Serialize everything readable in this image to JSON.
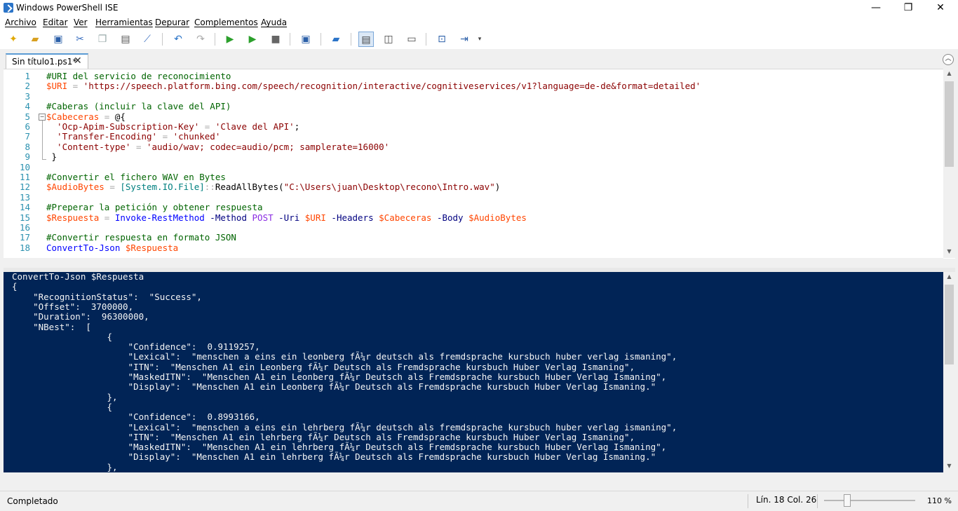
{
  "window": {
    "title": "Windows PowerShell ISE",
    "minimize": "—",
    "restore": "❐",
    "close": "✕"
  },
  "menu": [
    "Archivo",
    "Editar",
    "Ver",
    "Herramientas",
    "Depurar",
    "Complementos",
    "Ayuda"
  ],
  "toolbar": {
    "icons": [
      "new-icon",
      "open-icon",
      "save-icon",
      "cut-icon",
      "copy-icon",
      "paste-icon",
      "clear-icon",
      "undo-icon",
      "redo-icon",
      "run-icon",
      "run-selection-icon",
      "stop-icon",
      "new-remote-tab-icon",
      "start-powershell-icon",
      "layout-top-icon",
      "layout-right-icon",
      "layout-max-icon",
      "show-commands-icon",
      "show-addon-icon",
      "toolbar-overflow-icon"
    ]
  },
  "tab": {
    "label": "Sin título1.ps1*",
    "close": "✕"
  },
  "editor": {
    "lines": [
      {
        "n": "1",
        "tokens": [
          [
            "c-com",
            "#URI del servicio de reconocimiento"
          ]
        ]
      },
      {
        "n": "2",
        "tokens": [
          [
            "c-var",
            "$URI"
          ],
          [
            "c-op",
            " = "
          ],
          [
            "c-str",
            "'https://speech.platform.bing.com/speech/recognition/interactive/cognitiveservices/v1?language=de-de&format=detailed'"
          ]
        ]
      },
      {
        "n": "3",
        "tokens": []
      },
      {
        "n": "4",
        "tokens": [
          [
            "c-com",
            "#Caberas (incluir la clave del API)"
          ]
        ]
      },
      {
        "n": "5",
        "tokens": [
          [
            "c-var",
            "$Cabeceras"
          ],
          [
            "c-op",
            " = "
          ],
          [
            "c-txt",
            "@{"
          ]
        ]
      },
      {
        "n": "6",
        "tokens": [
          [
            "c-str",
            "  'Ocp-Apim-Subscription-Key'"
          ],
          [
            "c-op",
            " = "
          ],
          [
            "c-str",
            "'Clave del API'"
          ],
          [
            "c-txt",
            ";"
          ]
        ]
      },
      {
        "n": "7",
        "tokens": [
          [
            "c-str",
            "  'Transfer-Encoding'"
          ],
          [
            "c-op",
            " = "
          ],
          [
            "c-str",
            "'chunked'"
          ]
        ]
      },
      {
        "n": "8",
        "tokens": [
          [
            "c-str",
            "  'Content-type'"
          ],
          [
            "c-op",
            " = "
          ],
          [
            "c-str",
            "'audio/wav; codec=audio/pcm; samplerate=16000'"
          ]
        ]
      },
      {
        "n": "9",
        "tokens": [
          [
            "c-txt",
            " }"
          ]
        ]
      },
      {
        "n": "10",
        "tokens": []
      },
      {
        "n": "11",
        "tokens": [
          [
            "c-com",
            "#Convertir el fichero WAV en Bytes"
          ]
        ]
      },
      {
        "n": "12",
        "tokens": [
          [
            "c-var",
            "$AudioBytes"
          ],
          [
            "c-op",
            " = "
          ],
          [
            "c-type",
            "[System.IO.File]"
          ],
          [
            "c-op",
            "::"
          ],
          [
            "c-txt",
            "ReadAllBytes("
          ],
          [
            "c-str",
            "\"C:\\Users\\juan\\Desktop\\recono\\Intro.wav\""
          ],
          [
            "c-txt",
            ")"
          ]
        ]
      },
      {
        "n": "13",
        "tokens": []
      },
      {
        "n": "14",
        "tokens": [
          [
            "c-com",
            "#Preperar la petición y obtener respuesta"
          ]
        ]
      },
      {
        "n": "15",
        "tokens": [
          [
            "c-var",
            "$Respuesta"
          ],
          [
            "c-op",
            " = "
          ],
          [
            "c-cmd",
            "Invoke-RestMethod"
          ],
          [
            "c-param",
            " -Method "
          ],
          [
            "c-kw",
            "POST"
          ],
          [
            "c-param",
            " -Uri "
          ],
          [
            "c-var",
            "$URI"
          ],
          [
            "c-param",
            " -Headers "
          ],
          [
            "c-var",
            "$Cabeceras"
          ],
          [
            "c-param",
            " -Body "
          ],
          [
            "c-var",
            "$AudioBytes"
          ]
        ]
      },
      {
        "n": "16",
        "tokens": []
      },
      {
        "n": "17",
        "tokens": [
          [
            "c-com",
            "#Convertir respuesta en formato JSON"
          ]
        ]
      },
      {
        "n": "18",
        "tokens": [
          [
            "c-cmd",
            "ConvertTo-Json"
          ],
          [
            "c-txt",
            " "
          ],
          [
            "c-var",
            "$Respuesta"
          ]
        ]
      }
    ]
  },
  "console": {
    "lines": [
      "ConvertTo-Json $Respuesta",
      "{",
      "    \"RecognitionStatus\":  \"Success\",",
      "    \"Offset\":  3700000,",
      "    \"Duration\":  96300000,",
      "    \"NBest\":  [",
      "                  {",
      "                      \"Confidence\":  0.9119257,",
      "                      \"Lexical\":  \"menschen a eins ein leonberg fÃ¼r deutsch als fremdsprache kursbuch huber verlag ismaning\",",
      "                      \"ITN\":  \"Menschen A1 ein Leonberg fÃ¼r Deutsch als Fremdsprache kursbuch Huber Verlag Ismaning\",",
      "                      \"MaskedITN\":  \"Menschen A1 ein Leonberg fÃ¼r Deutsch als Fremdsprache kursbuch Huber Verlag Ismaning\",",
      "                      \"Display\":  \"Menschen A1 ein Leonberg fÃ¼r Deutsch als Fremdsprache kursbuch Huber Verlag Ismaning.\"",
      "                  },",
      "                  {",
      "                      \"Confidence\":  0.8993166,",
      "                      \"Lexical\":  \"menschen a eins ein lehrberg fÃ¼r deutsch als fremdsprache kursbuch huber verlag ismaning\",",
      "                      \"ITN\":  \"Menschen A1 ein lehrberg fÃ¼r Deutsch als Fremdsprache kursbuch Huber Verlag Ismaning\",",
      "                      \"MaskedITN\":  \"Menschen A1 ein lehrberg fÃ¼r Deutsch als Fremdsprache kursbuch Huber Verlag Ismaning\",",
      "                      \"Display\":  \"Menschen A1 ein lehrberg fÃ¼r Deutsch als Fremdsprache kursbuch Huber Verlag Ismaning.\"",
      "                  },"
    ]
  },
  "status": {
    "text": "Completado",
    "position": "Lín. 18  Col. 26",
    "zoom": "110 %"
  },
  "colors": {
    "console_bg": "#012456",
    "console_text": "#f5f5f5",
    "line_numbers": "#2b91af"
  }
}
